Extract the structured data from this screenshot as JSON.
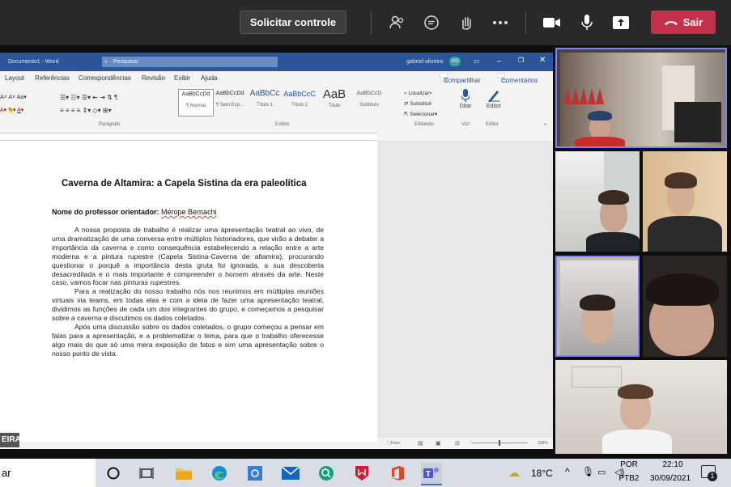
{
  "toolbar": {
    "request_control": "Solicitar controle",
    "leave_label": "Sair",
    "icons": [
      "people-icon",
      "chat-icon",
      "raise-hand-icon",
      "more-icon",
      "camera-icon",
      "mic-icon",
      "share-icon",
      "phone-icon"
    ]
  },
  "word": {
    "window_title": "Documento1 - Word",
    "search_placeholder": "Pesquisar",
    "user": "gabriel oliveira",
    "user_initials": "GO",
    "menu": [
      "Layout",
      "Referências",
      "Correspondências",
      "Revisão",
      "Exibir",
      "Ajuda"
    ],
    "share_label": "Compartilhar",
    "comments_label": "Comentários",
    "styles": [
      {
        "preview": "AaBbCcDd",
        "name": "¶ Normal"
      },
      {
        "preview": "AaBbCcDd",
        "name": "¶ Sem Esp..."
      },
      {
        "preview": "AaBbCc",
        "name": "Título 1"
      },
      {
        "preview": "AaBbCcC",
        "name": "Título 2"
      },
      {
        "preview": "AaB",
        "name": "Título"
      },
      {
        "preview": "AaBbCcD",
        "name": "Subtítulo"
      }
    ],
    "group_labels": {
      "paragraph": "Parágrafo",
      "styles": "Estilos",
      "editing": "Editando",
      "voice": "Voz",
      "editor": "Editor"
    },
    "editing": [
      "Localizar",
      "Substituir",
      "Selecionar"
    ],
    "dictate": "Ditar",
    "editor": "Editor",
    "doc": {
      "title": "Caverna de Altamira: a Capela Sistina da era paleolítica",
      "prof_label": "Nome do professor orientador:",
      "prof_name": "Mérope Bernachi",
      "p1": "A nossa proposta de trabalho é realizar uma apresentação teatral ao vivo, de uma dramatização de uma conversa entre múltiplos historiadores, que virão a debater a importância da caverna e como consequência estabelecendo a relação entre a arte moderna e a pintura rupestre (Capela Sistina-Caverna de altamira), procurando questionar o porquê a importância desta gruta foi ignorada, a sua descoberta desacreditada e o mais importante é compreender o homem através da arte. Neste caso, vamos focar nas pinturas rupestres.",
      "p2": "Para a realização do nosso trabalho nós nos reunimos em múltiplas reuniões virtuais via teams, em todas elas e com a ideia de fazer uma apresentação teatral, dividimos as funções de cada um dos integrantes do grupo, e começamos a pesquisar sobre a caverna e discutimos os dados coletados.",
      "p3": "Após uma discussão sobre os dados coletados, o grupo começou a pensar em falas para a apresentação, e a problematizar o tema, para que o trabalho oferecesse algo mais do que só uma mera exposição de fatos e sim uma apresentação sobre o nosso ponto de vista."
    },
    "focus": "Foco",
    "zoom": "100%",
    "name_tag": "EIRA"
  },
  "taskbar": {
    "search_text": "ar",
    "weather": "18°C",
    "lang1": "POR",
    "lang2": "PTB2",
    "time": "22:10",
    "date": "30/09/2021",
    "notifications": "1"
  }
}
